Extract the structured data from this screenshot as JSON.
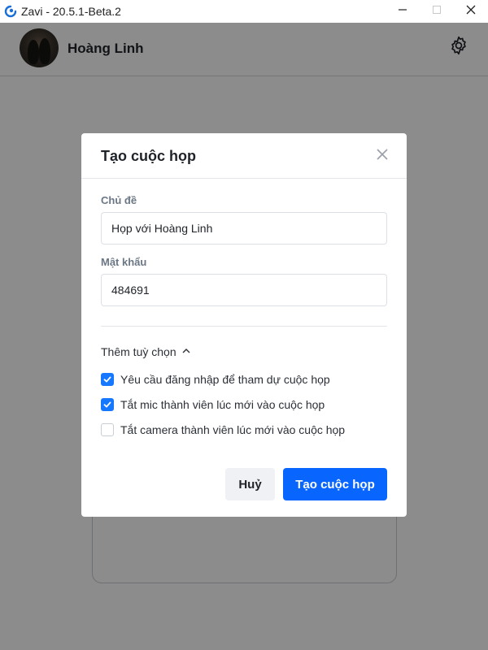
{
  "window": {
    "title": "Zavi - 20.5.1-Beta.2",
    "icons": {
      "logo": "zavi-logo-icon",
      "minimize": "minimize-icon",
      "maximize": "maximize-icon",
      "close": "close-icon"
    }
  },
  "header": {
    "user_name": "Hoàng Linh",
    "settings_icon": "gear-icon"
  },
  "modal": {
    "title": "Tạo cuộc họp",
    "close_icon": "close-icon",
    "topic": {
      "label": "Chủ đề",
      "value": "Họp với Hoàng Linh"
    },
    "password": {
      "label": "Mật khẩu",
      "value": "484691"
    },
    "more_options_label": "Thêm tuỳ chọn",
    "more_options_icon": "chevron-up-icon",
    "options": [
      {
        "label": "Yêu cầu đăng nhập để tham dự cuộc họp",
        "checked": true
      },
      {
        "label": "Tắt mic thành viên lúc mới vào cuộc họp",
        "checked": true
      },
      {
        "label": "Tắt camera thành viên lúc mới vào cuộc họp",
        "checked": false
      }
    ],
    "cancel_label": "Huỷ",
    "create_label": "Tạo cuộc họp"
  },
  "colors": {
    "primary": "#0866ff",
    "checkbox_checked": "#1677ff",
    "overlay": "rgba(0,0,0,0.45)"
  }
}
